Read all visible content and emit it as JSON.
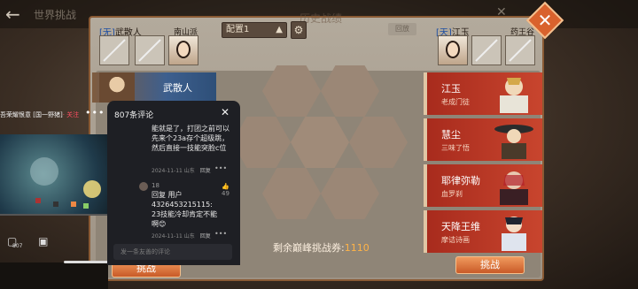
{
  "background": {
    "back_icon": "back-arrow-icon",
    "title": "世界挑战",
    "panel_title": "历史战绩"
  },
  "config": {
    "selected": "配置1",
    "replay_label": "回放"
  },
  "left_team": {
    "tag": "[无]",
    "name": "武散人",
    "faction": "南山派",
    "hero_name": "武散人"
  },
  "right_team": {
    "tag": "[天]",
    "name": "江玉",
    "faction": "药王谷"
  },
  "roster": [
    {
      "name": "江玉",
      "subtitle": "老成门徒",
      "color": "#b22e1f"
    },
    {
      "name": "慧尘",
      "subtitle": "三味了悟",
      "color": "#b22e1f"
    },
    {
      "name": "耶律弥勒",
      "subtitle": "血罗刹",
      "color": "#b22e1f"
    },
    {
      "name": "天降王维",
      "subtitle": "摩诘诗画",
      "color": "#b22e1f"
    }
  ],
  "remaining": {
    "label": "剩余巅峰挑战券:",
    "value": "1110"
  },
  "buttons": {
    "challenge_left": "挑战",
    "challenge_right": "挑战"
  },
  "comments": {
    "count_label": "807条评论",
    "items": [
      {
        "text": "能就是了，打团之前可以先来个23a存个超级跳，然后直接一技能突脸c位",
        "meta": "2024-11-11 山东",
        "reply": "回复"
      },
      {
        "user": "18",
        "text_prefix": "回复 用户4326453215115: ",
        "text": "23技能冷却肯定不能啊😊",
        "meta": "2024-11-11 山东",
        "reply": "回复",
        "likes": "49"
      }
    ],
    "input_placeholder": "发一条友善的评论"
  },
  "video": {
    "header": "吾荣耀恨意 [国一野猪]",
    "follow": "· 关注",
    "side_count": "807"
  }
}
